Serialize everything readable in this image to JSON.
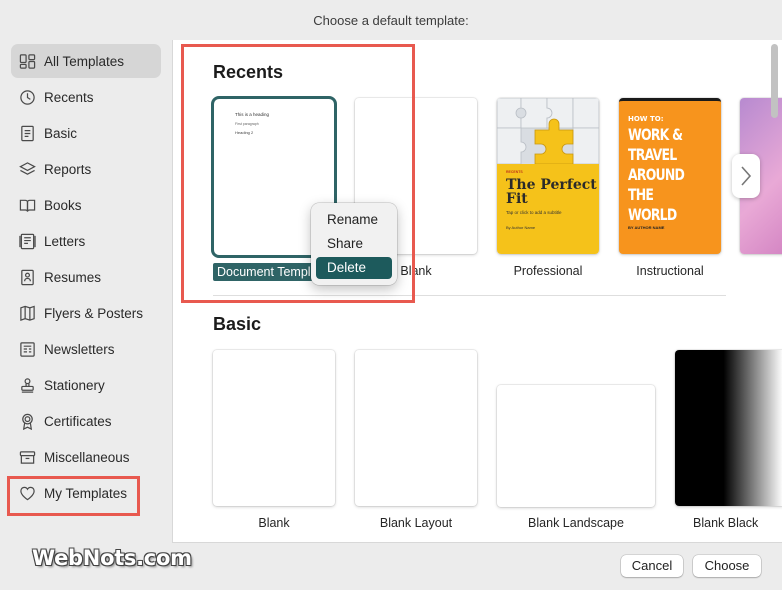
{
  "window": {
    "title": "Choose a default template:"
  },
  "sidebar": {
    "items": [
      {
        "label": "All Templates",
        "icon": "grid-icon",
        "active": true
      },
      {
        "label": "Recents",
        "icon": "clock-icon"
      },
      {
        "label": "Basic",
        "icon": "doc-icon"
      },
      {
        "label": "Reports",
        "icon": "report-icon"
      },
      {
        "label": "Books",
        "icon": "book-icon"
      },
      {
        "label": "Letters",
        "icon": "letter-icon"
      },
      {
        "label": "Resumes",
        "icon": "resume-icon"
      },
      {
        "label": "Flyers & Posters",
        "icon": "flyer-icon"
      },
      {
        "label": "Newsletters",
        "icon": "newsletter-icon"
      },
      {
        "label": "Stationery",
        "icon": "stamp-icon"
      },
      {
        "label": "Certificates",
        "icon": "ribbon-icon"
      },
      {
        "label": "Miscellaneous",
        "icon": "box-icon"
      },
      {
        "label": "My Templates",
        "icon": "heart-icon"
      }
    ]
  },
  "recents": {
    "title": "Recents",
    "templates": [
      {
        "name": "Document Template",
        "preview": {
          "line1": "This is a heading",
          "line2": "First paragraph",
          "line3": "Heading 2"
        }
      },
      {
        "name": "Blank"
      },
      {
        "name": "Professional",
        "preview": {
          "kicker": "RECENTS",
          "title": "The Perfect Fit",
          "subtitle": "Tap or click to add a subtitle",
          "author": "By Author Name"
        }
      },
      {
        "name": "Instructional",
        "preview": {
          "top": "HOW TO:",
          "title": "WORK & TRAVEL AROUND THE WORLD",
          "author": "BY AUTHOR NAME"
        }
      }
    ]
  },
  "basic": {
    "title": "Basic",
    "templates": [
      {
        "name": "Blank"
      },
      {
        "name": "Blank Layout"
      },
      {
        "name": "Blank Landscape"
      },
      {
        "name": "Blank Black"
      }
    ]
  },
  "context_menu": {
    "items": [
      "Rename",
      "Share",
      "Delete"
    ],
    "highlighted": "Delete"
  },
  "footer": {
    "cancel": "Cancel",
    "choose": "Choose"
  },
  "watermark": "WebNots.com",
  "colors": {
    "highlight": "#1d5a5c",
    "annotation": "#e8594f",
    "flyer_yellow": "#f5c21a",
    "instructional_orange": "#f7941d"
  }
}
